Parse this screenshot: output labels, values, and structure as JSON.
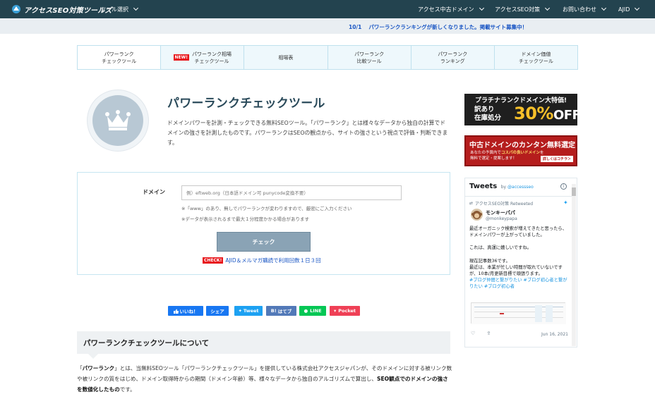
{
  "header": {
    "logo_text": "アクセスSEO対策ツールズ",
    "nav": [
      {
        "label": "ツール選択"
      },
      {
        "label": "アクセス中古ドメイン"
      },
      {
        "label": "アクセスSEO対策"
      },
      {
        "label": "お問い合わせ"
      },
      {
        "label": "AJID"
      }
    ]
  },
  "notice": {
    "date": "10/1",
    "text": "パワーランクランキングが新しくなりました。掲載サイト募集中！"
  },
  "tabs": [
    {
      "line1": "パワーランク",
      "line2": "チェックツール"
    },
    {
      "badge": "NEW!",
      "line1": "パワーランク相場",
      "line2": "チェックツール"
    },
    {
      "line1": "相場表",
      "line2": ""
    },
    {
      "line1": "パワーランク",
      "line2": "比較ツール"
    },
    {
      "line1": "パワーランク",
      "line2": "ランキング"
    },
    {
      "line1": "ドメイン価値",
      "line2": "チェックツール"
    }
  ],
  "hero": {
    "title": "パワーランクチェックツール",
    "description": "ドメインパワーを計測・チェックできる無料SEOツール。「パワーランク」とは様々なデータから独自の計算でドメインの強さを計測したものです。パワーランクはSEOの観点から、サイトの強さという視点で評価・判断できます。"
  },
  "form": {
    "domain_label": "ドメイン",
    "domain_placeholder": "例）eftweb.org（日本語ドメイン可 punycode変換不要）",
    "note1": "※「www」のあり、無しでパワーランクが変わりますので、厳密にご入力ください",
    "note2": "※データが表示されるまで最大１分程度かかる場合があります",
    "check_button": "チェック",
    "check_badge": "CHECK!",
    "check_text": "AJID＆メルマガ購読で利用回数１日３回"
  },
  "share": {
    "like": "いいね！",
    "share": "シェア",
    "tweet": "Tweet",
    "hatena": "はてブ",
    "line": "LINE",
    "pocket": "Pocket",
    "colors": {
      "like": "#1877f2",
      "share": "#1877f2",
      "tweet": "#1da1f2",
      "hatena": "#5279b8",
      "line": "#06c755",
      "pocket": "#ef4056"
    }
  },
  "section": {
    "heading": "パワーランクチェックツールについて",
    "p1_open": "「",
    "p1_bold1": "パワーランク",
    "p1_mid": "」とは、当無料SEOツール「パワーランクチェックツール」を提供している株式会社アクセスジャパンが、そのドメインに対する被リンク数や被リンクの質をはじめ、ドメイン取得時からの期間（ドメイン年齢）等、様々なデータから独自のアルゴリズムで算出し、",
    "p1_bold2": "SEO観点でのドメインの強さを数値化したもの",
    "p1_end": "です。"
  },
  "ads": {
    "ad1_top": "プラチナランクドメイン大特価!",
    "ad1_left1": "訳あり",
    "ad1_left2": "在庫処分",
    "ad1_big": "30%",
    "ad1_off": "OFF",
    "ad2_title": "中古ドメインのカンタン無料選定",
    "ad2_sub1": "あなたの予算内で",
    "ad2_sub_bold": "コスパの良いドメイン",
    "ad2_sub2": "を",
    "ad2_sub3": "無料で選定・提案します！",
    "ad2_btn": "詳しくはコチラ＞"
  },
  "tweets": {
    "title": "Tweets",
    "by": "by",
    "account": "@accessseo",
    "retweeted": "アクセスSEO対策 Retweeted",
    "name": "モンキーパパ",
    "handle": "@monkeypapa",
    "text1": "最近オーガニック検索が増えてきたと思ったら、ドメインパワーが上がっていました。",
    "text2": "これは、真運に嬉しいですね。",
    "text3": "現在記事数36です。",
    "text4": "最近は、本業が忙しい時間が取れていないですが、10本/月更新目標で頑張ります。",
    "hashtags": "#ブログ仲間と繋がりたい #ブログ初心者と繋がりたい #ブログ初心者",
    "date": "Jun 16, 2021"
  }
}
